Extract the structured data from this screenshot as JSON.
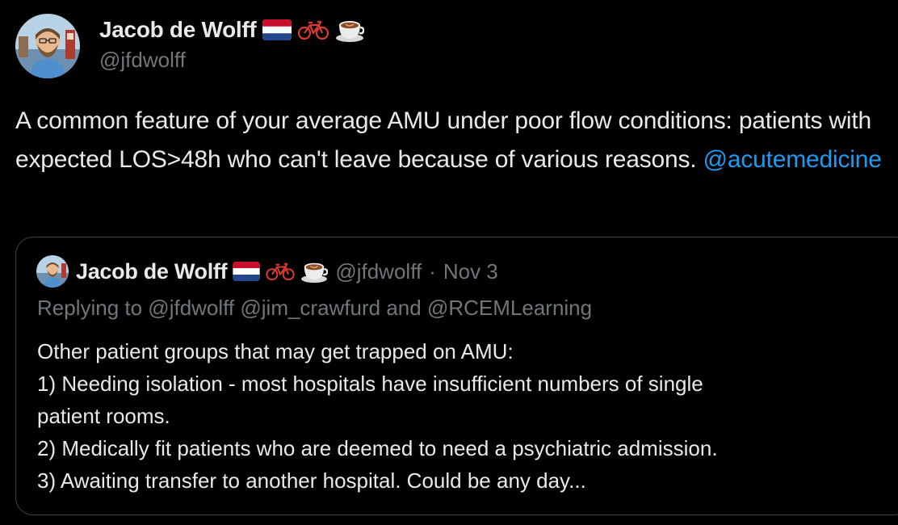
{
  "author": {
    "display_name": "Jacob de Wolff",
    "handle": "@jfdwolff",
    "avatar_icon": "avatar-cartoon-man-icon",
    "emojis": [
      "netherlands-flag-icon",
      "bicycle-icon",
      "coffee-cup-icon"
    ]
  },
  "tweet": {
    "text_before": "A common feature of your average AMU under poor flow conditions: patients with expected LOS>48h who can't leave because of various reasons. ",
    "mention": "@acutemedicine"
  },
  "quote": {
    "display_name": "Jacob de Wolff",
    "handle": "@jfdwolff",
    "separator": "·",
    "date": "Nov 3",
    "replying_to": "Replying to @jfdwolff @jim_crawfurd and @RCEMLearning",
    "lines": [
      "Other patient groups that may get trapped on AMU:",
      "1) Needing isolation - most hospitals have insufficient numbers of single",
      "patient rooms.",
      "2) Medically fit patients who are deemed to need a psychiatric admission.",
      "3) Awaiting transfer to another hospital. Could be any day..."
    ]
  },
  "colors": {
    "background": "#000000",
    "text": "#e7e9ea",
    "secondary_text": "#71767b",
    "link": "#1d9bf0",
    "border": "#3e4144"
  }
}
